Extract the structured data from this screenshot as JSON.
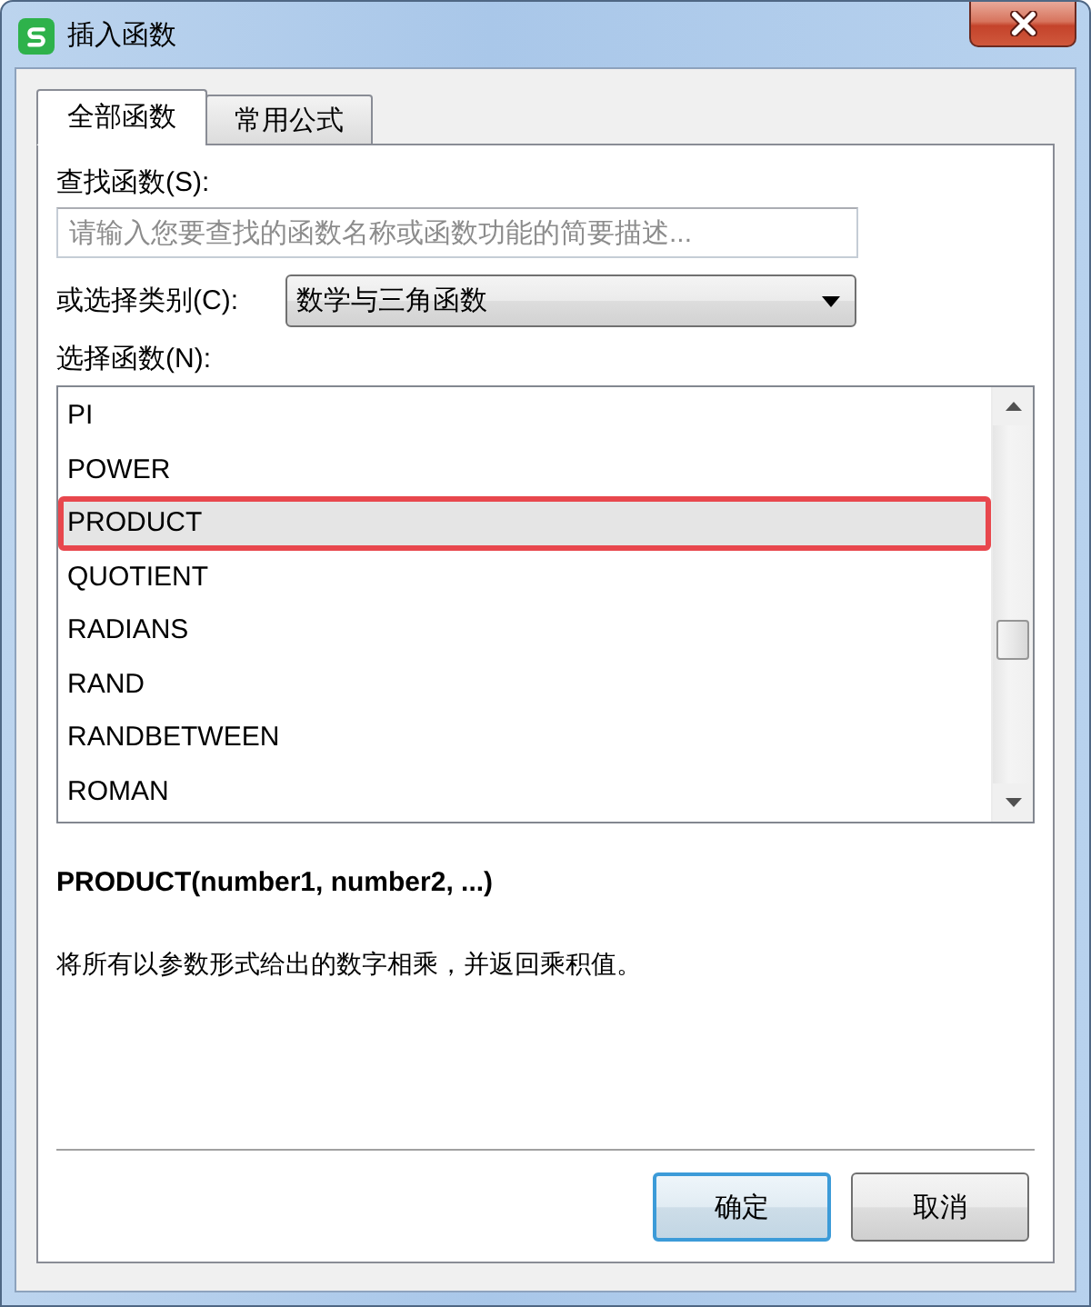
{
  "window": {
    "title": "插入函数"
  },
  "tabs": [
    {
      "label": "全部函数",
      "selected": true
    },
    {
      "label": "常用公式",
      "selected": false
    }
  ],
  "search": {
    "label": "查找函数(S):",
    "placeholder": "请输入您要查找的函数名称或函数功能的简要描述..."
  },
  "category": {
    "label": "或选择类别(C):",
    "value": "数学与三角函数"
  },
  "function_list": {
    "label": "选择函数(N):",
    "items": [
      {
        "name": "PI",
        "selected": false,
        "highlighted": false
      },
      {
        "name": "POWER",
        "selected": false,
        "highlighted": false
      },
      {
        "name": "PRODUCT",
        "selected": true,
        "highlighted": true
      },
      {
        "name": "QUOTIENT",
        "selected": false,
        "highlighted": false
      },
      {
        "name": "RADIANS",
        "selected": false,
        "highlighted": false
      },
      {
        "name": "RAND",
        "selected": false,
        "highlighted": false
      },
      {
        "name": "RANDBETWEEN",
        "selected": false,
        "highlighted": false
      },
      {
        "name": "ROMAN",
        "selected": false,
        "highlighted": false
      }
    ]
  },
  "formula": {
    "signature": "PRODUCT(number1, number2, ...)",
    "description": "将所有以参数形式给出的数字相乘，并返回乘积值。"
  },
  "buttons": [
    {
      "label": "确定",
      "default": true
    },
    {
      "label": "取消",
      "default": false
    }
  ]
}
